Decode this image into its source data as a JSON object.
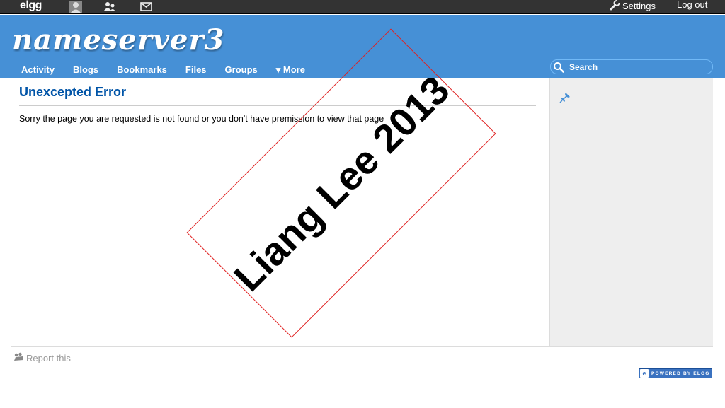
{
  "topbar": {
    "logo_text": "elgg",
    "logo_mark": ".",
    "icons": [
      "profile-icon",
      "friends-icon",
      "messages-icon",
      "wrench-icon"
    ],
    "settings_label": "Settings",
    "logout_label": "Log out"
  },
  "header": {
    "site_name": "nameserver3",
    "nav": [
      {
        "label": "Activity"
      },
      {
        "label": "Blogs"
      },
      {
        "label": "Bookmarks"
      },
      {
        "label": "Files"
      },
      {
        "label": "Groups"
      },
      {
        "label": "▾ More"
      }
    ],
    "search": {
      "placeholder": "Search"
    }
  },
  "main": {
    "title": "Unexcepted Error",
    "message": "Sorry the page you are requested is not found or you don't have premission to view that page"
  },
  "sidebar": {
    "icon": "pin-icon"
  },
  "footer": {
    "report_label": "Report this",
    "powered_badge": "POWERED BY ELGG"
  },
  "watermark": {
    "text": "Liang Lee 2013"
  },
  "colors": {
    "topbar": "#333333",
    "header": "#4690d6",
    "title": "#0054a7",
    "sidebar": "#eeeeee",
    "watermark_border": "#e02020"
  }
}
